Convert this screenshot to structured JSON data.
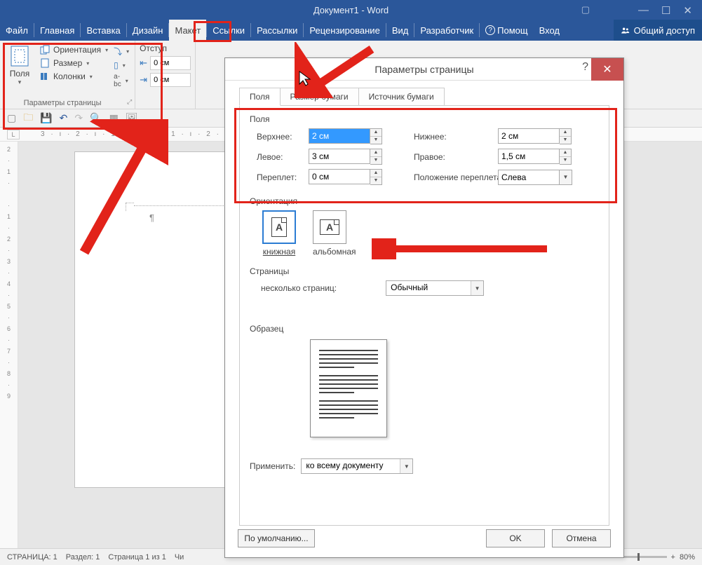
{
  "titlebar": {
    "title": "Документ1 - Word"
  },
  "menubar": {
    "file": "Файл",
    "home": "Главная",
    "insert": "Вставка",
    "design": "Дизайн",
    "layout": "Макет",
    "references": "Ссылки",
    "mailings": "Рассылки",
    "review": "Рецензирование",
    "view": "Вид",
    "developer": "Разработчик",
    "help": "Помощ",
    "signin": "Вход",
    "share": "Общий доступ"
  },
  "ribbon": {
    "page_setup_group": "Параметры страницы",
    "margins": "Поля",
    "orientation": "Ориентация",
    "size": "Размер",
    "columns": "Колонки",
    "indent_label": "Отступ",
    "indent_left": "0 см",
    "indent_right": "0 см"
  },
  "ruler_marks": "3 · ı · 2 · ı · 1 · ı ·     · ı · 1 · ı · 2 ·",
  "ruler_corner": "L",
  "statusbar": {
    "page": "СТРАНИЦА: 1",
    "section": "Раздел: 1",
    "pageof": "Страница 1 из 1",
    "words": "Чи",
    "zoom": "80%"
  },
  "dialog": {
    "title": "Параметры страницы",
    "tabs": {
      "margins": "Поля",
      "paper": "Размер бумаги",
      "source": "Источник бумаги"
    },
    "fields_label": "Поля",
    "top_label": "Верхнее:",
    "top_value": "2 см",
    "bottom_label": "Нижнее:",
    "bottom_value": "2 см",
    "left_label": "Левое:",
    "left_value": "3 см",
    "right_label": "Правое:",
    "right_value": "1,5 см",
    "gutter_label": "Переплет:",
    "gutter_value": "0 см",
    "gutter_pos_label": "Положение переплета:",
    "gutter_pos_value": "Слева",
    "orientation_label": "Ориентация",
    "portrait": "книжная",
    "landscape": "альбомная",
    "pages_label": "Страницы",
    "multipages_label": "несколько страниц:",
    "multipages_value": "Обычный",
    "preview_label": "Образец",
    "apply_label": "Применить:",
    "apply_value": "ко всему документу",
    "default_btn": "По умолчанию...",
    "ok": "OK",
    "cancel": "Отмена"
  },
  "vruler_marks": [
    "2",
    "·",
    "1",
    "·",
    "",
    "·",
    "1",
    "·",
    "2",
    "·",
    "3",
    "·",
    "4",
    "·",
    "5",
    "·",
    "6",
    "·",
    "7",
    "·",
    "8",
    "·",
    "9"
  ]
}
